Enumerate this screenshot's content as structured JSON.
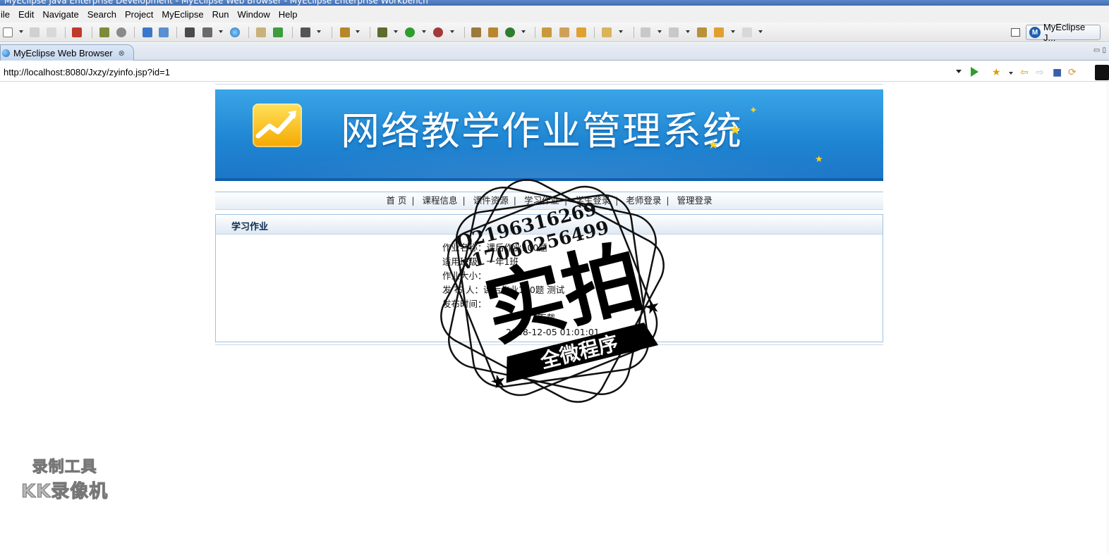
{
  "window": {
    "title": "MyEclipse Java Enterprise Development - MyEclipse Web Browser - MyEclipse Enterprise Workbench"
  },
  "menu": [
    "ile",
    "Edit",
    "Navigate",
    "Search",
    "Project",
    "MyEclipse",
    "Run",
    "Window",
    "Help"
  ],
  "perspective": {
    "label": "MyEclipse J..."
  },
  "editor_tab": {
    "label": "MyEclipse Web Browser",
    "close": "⊗"
  },
  "address": {
    "url": "http://localhost:8080/Jxzy/zyinfo.jsp?id=1"
  },
  "site": {
    "banner_title": "网络教学作业管理系统",
    "nav": [
      "首 页",
      "课程信息",
      "课件资源",
      "学习作业",
      "学生登录",
      "老师登录",
      "管理登录"
    ],
    "nav_sep": "|",
    "panel_title": "学习作业",
    "info_lines": [
      "作业名称：课后作业100题",
      "适用班级：一年1班",
      "作业大小：",
      "发 布 人：课后作业100题 测试",
      "发布时间："
    ],
    "download": "下载",
    "publish_time": "2008-12-05 01:01:01"
  },
  "watermark": {
    "qq": "Q2196316269",
    "vx": "v17060256499",
    "big": "实拍",
    "ribbon": "全微程序",
    "recorder_line1": "录制工具",
    "recorder_line2": "KK录像机"
  },
  "colors": {
    "banner": "#1f86d3",
    "border": "#9ec2df",
    "panel_title": "#0d2b4d"
  }
}
